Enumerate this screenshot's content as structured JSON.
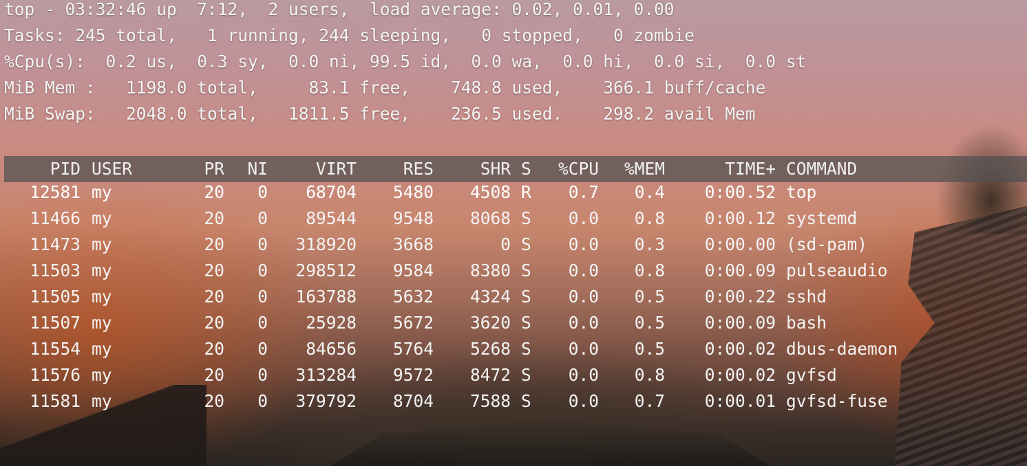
{
  "summary": {
    "line1": "top - 03:32:46 up  7:12,  2 users,  load average: 0.02, 0.01, 0.00",
    "line2": "Tasks: 245 total,   1 running, 244 sleeping,   0 stopped,   0 zombie",
    "line3": "%Cpu(s):  0.2 us,  0.3 sy,  0.0 ni, 99.5 id,  0.0 wa,  0.0 hi,  0.0 si,  0.0 st",
    "line4": "MiB Mem :   1198.0 total,     83.1 free,    748.8 used,    366.1 buff/cache",
    "line5": "MiB Swap:   2048.0 total,   1811.5 free,    236.5 used.    298.2 avail Mem"
  },
  "columns": {
    "pid": "PID",
    "user": "USER",
    "pr": "PR",
    "ni": "NI",
    "virt": "VIRT",
    "res": "RES",
    "shr": "SHR",
    "s": "S",
    "cpu": "%CPU",
    "mem": "%MEM",
    "time": "TIME+",
    "command": "COMMAND"
  },
  "processes": [
    {
      "pid": "12581",
      "user": "my",
      "pr": "20",
      "ni": "0",
      "virt": "68704",
      "res": "5480",
      "shr": "4508",
      "s": "R",
      "cpu": "0.7",
      "mem": "0.4",
      "time": "0:00.52",
      "command": "top"
    },
    {
      "pid": "11466",
      "user": "my",
      "pr": "20",
      "ni": "0",
      "virt": "89544",
      "res": "9548",
      "shr": "8068",
      "s": "S",
      "cpu": "0.0",
      "mem": "0.8",
      "time": "0:00.12",
      "command": "systemd"
    },
    {
      "pid": "11473",
      "user": "my",
      "pr": "20",
      "ni": "0",
      "virt": "318920",
      "res": "3668",
      "shr": "0",
      "s": "S",
      "cpu": "0.0",
      "mem": "0.3",
      "time": "0:00.00",
      "command": "(sd-pam)"
    },
    {
      "pid": "11503",
      "user": "my",
      "pr": "20",
      "ni": "0",
      "virt": "298512",
      "res": "9584",
      "shr": "8380",
      "s": "S",
      "cpu": "0.0",
      "mem": "0.8",
      "time": "0:00.09",
      "command": "pulseaudio"
    },
    {
      "pid": "11505",
      "user": "my",
      "pr": "20",
      "ni": "0",
      "virt": "163788",
      "res": "5632",
      "shr": "4324",
      "s": "S",
      "cpu": "0.0",
      "mem": "0.5",
      "time": "0:00.22",
      "command": "sshd"
    },
    {
      "pid": "11507",
      "user": "my",
      "pr": "20",
      "ni": "0",
      "virt": "25928",
      "res": "5672",
      "shr": "3620",
      "s": "S",
      "cpu": "0.0",
      "mem": "0.5",
      "time": "0:00.09",
      "command": "bash"
    },
    {
      "pid": "11554",
      "user": "my",
      "pr": "20",
      "ni": "0",
      "virt": "84656",
      "res": "5764",
      "shr": "5268",
      "s": "S",
      "cpu": "0.0",
      "mem": "0.5",
      "time": "0:00.02",
      "command": "dbus-daemon"
    },
    {
      "pid": "11576",
      "user": "my",
      "pr": "20",
      "ni": "0",
      "virt": "313284",
      "res": "9572",
      "shr": "8472",
      "s": "S",
      "cpu": "0.0",
      "mem": "0.8",
      "time": "0:00.02",
      "command": "gvfsd"
    },
    {
      "pid": "11581",
      "user": "my",
      "pr": "20",
      "ni": "0",
      "virt": "379792",
      "res": "8704",
      "shr": "7588",
      "s": "S",
      "cpu": "0.0",
      "mem": "0.7",
      "time": "0:00.01",
      "command": "gvfsd-fuse"
    }
  ]
}
